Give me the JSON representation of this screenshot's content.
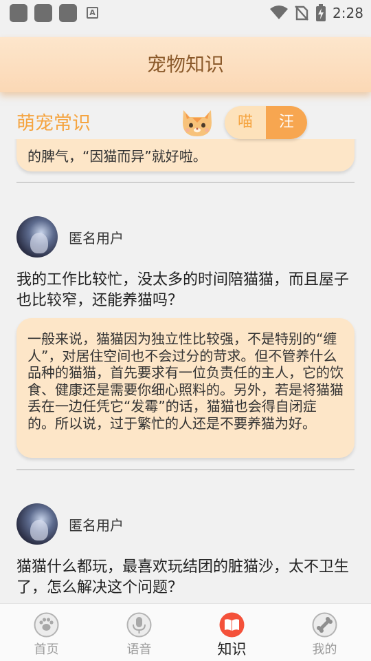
{
  "status_bar": {
    "time": "2:28",
    "a_label": "A"
  },
  "header": {
    "title": "宠物知识"
  },
  "section": {
    "title": "萌宠常识",
    "toggle": {
      "options": [
        "喵",
        "汪"
      ],
      "selected": "汪"
    }
  },
  "feed": {
    "top_answer_tail": "的脾气，“因猫而异”就好啦。",
    "posts": [
      {
        "user": "匿名用户",
        "question": "我的工作比较忙，没太多的时间陪猫猫，而且屋子也比较窄，还能养猫吗？",
        "answer": "一般来说，猫猫因为独立性比较强，不是特别的“缠人”，对居住空间也不会过分的苛求。但不管养什么品种的猫猫，首先要求有一位负责任的主人，它的饮食、健康还是需要你细心照料的。另外，若是将猫猫丢在一边任凭它“发霉”的话，猫猫也会得自闭症的。所以说，过于繁忙的人还是不要养猫为好。"
      },
      {
        "user": "匿名用户",
        "question": "猫猫什么都玩，最喜欢玩结团的脏猫沙，太不卫生了，怎么解决这个问题？"
      }
    ]
  },
  "bottom_nav": {
    "items": [
      {
        "label": "首页",
        "icon": "paw-icon",
        "active": false
      },
      {
        "label": "语音",
        "icon": "microphone-icon",
        "active": false
      },
      {
        "label": "知识",
        "icon": "book-icon",
        "active": true
      },
      {
        "label": "我的",
        "icon": "bone-icon",
        "active": false
      }
    ]
  },
  "colors": {
    "accent_orange": "#f5a440",
    "header_bg": "#fde6cc",
    "card_bg": "#fde6c8",
    "active_nav": "#f4513a"
  }
}
